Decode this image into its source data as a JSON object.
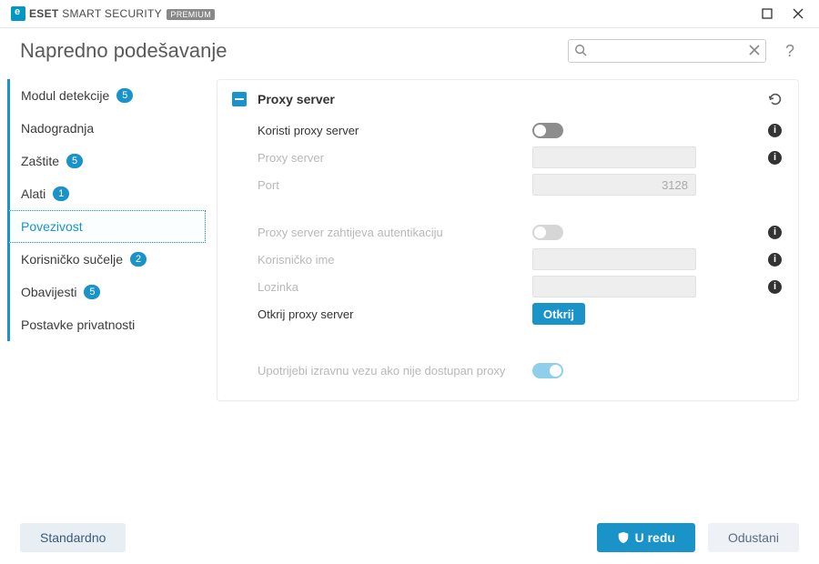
{
  "titlebar": {
    "brand_eset": "ESET",
    "brand_rest": "SMART SECURITY",
    "brand_badge": "PREMIUM"
  },
  "header": {
    "title": "Napredno podešavanje",
    "search_placeholder": "",
    "help": "?"
  },
  "sidebar": {
    "items": [
      {
        "label": "Modul detekcije",
        "badge": "5"
      },
      {
        "label": "Nadogradnja",
        "badge": ""
      },
      {
        "label": "Zaštite",
        "badge": "5"
      },
      {
        "label": "Alati",
        "badge": "1"
      },
      {
        "label": "Povezivost",
        "badge": ""
      },
      {
        "label": "Korisničko sučelje",
        "badge": "2"
      },
      {
        "label": "Obavijesti",
        "badge": "5"
      },
      {
        "label": "Postavke privatnosti",
        "badge": ""
      }
    ]
  },
  "panel": {
    "title": "Proxy server",
    "rows": {
      "use_proxy": "Koristi proxy server",
      "proxy_server": "Proxy server",
      "port": "Port",
      "port_value": "3128",
      "requires_auth": "Proxy server zahtijeva autentikaciju",
      "username": "Korisničko ime",
      "password": "Lozinka",
      "detect": "Otkrij proxy server",
      "detect_btn": "Otkrij",
      "direct": "Upotrijebi izravnu vezu ako nije dostupan proxy"
    }
  },
  "footer": {
    "default": "Standardno",
    "ok": "U redu",
    "cancel": "Odustani"
  }
}
